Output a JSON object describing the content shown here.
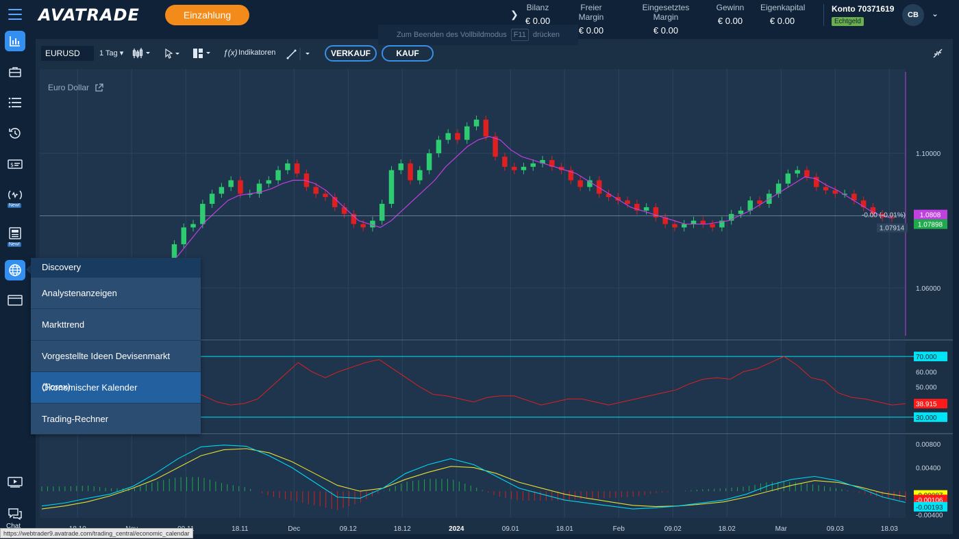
{
  "header": {
    "logo": "AVATRADE",
    "deposit_label": "Einzahlung",
    "stats": [
      {
        "label": "Bilanz",
        "value": "€ 0.00"
      },
      {
        "label": "Freier Margin",
        "value": "€ 0.00"
      },
      {
        "label": "Eingesetztes Margin",
        "value": "€ 0.00"
      },
      {
        "label": "Gewinn",
        "value": "€ 0.00"
      },
      {
        "label": "Eigenkapital",
        "value": "€ 0.00"
      }
    ],
    "account_label": "Konto 70371619",
    "account_badge": "Echtgeld",
    "avatar_initials": "CB",
    "fullscreen_hint_before": "Zum Beenden des Vollbildmodus",
    "fullscreen_key": "F11",
    "fullscreen_hint_after": "drücken"
  },
  "sidebar": {
    "new_badge": "New!",
    "chat_label": "Chat",
    "icons": [
      "chart-icon",
      "briefcase-icon",
      "list-icon",
      "history-icon",
      "money-icon",
      "signal-icon",
      "news-icon",
      "globe-icon",
      "window-icon",
      "video-icon",
      "chat-icon"
    ]
  },
  "toolbar": {
    "symbol": "EURUSD",
    "timeframe": "1 Tag",
    "indicators_label": "Indikatoren",
    "sell_label": "VERKAUF",
    "buy_label": "KAUF"
  },
  "chart_title": "Euro Dollar",
  "discovery_menu": {
    "title": "Discovery",
    "items": [
      "Analystenanzeigen",
      "Markttrend",
      "Vorgestellte Ideen Devisenmarkt (Forex)",
      "Ökonomischer Kalender",
      "Trading-Rechner"
    ],
    "selected_index": 3
  },
  "status_url": "https://webtrader9.avatrade.com/trading_central/economic_calendar",
  "chart_data": [
    {
      "type": "candlestick",
      "title": "Euro Dollar",
      "symbol": "EURUSD",
      "ylim": [
        1.045,
        1.125
      ],
      "y_ticks": [
        "1.10000",
        "1.06000"
      ],
      "last_price": "1.07898",
      "price_labels": [
        "1.0808",
        "1.07914"
      ],
      "change_label": "-0.00 (-0.01%)",
      "close_path": [
        1.064,
        1.065,
        1.066,
        1.0655,
        1.063,
        1.062,
        1.064,
        1.073,
        1.078,
        1.079,
        1.085,
        1.088,
        1.09,
        1.092,
        1.088,
        1.088,
        1.091,
        1.092,
        1.095,
        1.097,
        1.094,
        1.09,
        1.088,
        1.087,
        1.084,
        1.082,
        1.079,
        1.078,
        1.08,
        1.085,
        1.095,
        1.097,
        1.092,
        1.095,
        1.1,
        1.104,
        1.106,
        1.104,
        1.108,
        1.11,
        1.105,
        1.099,
        1.096,
        1.095,
        1.096,
        1.097,
        1.098,
        1.096,
        1.095,
        1.092,
        1.09,
        1.092,
        1.088,
        1.087,
        1.086,
        1.085,
        1.083,
        1.084,
        1.081,
        1.079,
        1.078,
        1.079,
        1.08,
        1.079,
        1.078,
        1.08,
        1.082,
        1.083,
        1.086,
        1.085,
        1.088,
        1.091,
        1.094,
        1.095,
        1.093,
        1.09,
        1.089,
        1.088,
        1.088,
        1.086,
        1.084,
        1.082,
        1.081,
        1.0808
      ],
      "ma_path": [
        1.06,
        1.061,
        1.062,
        1.063,
        1.064,
        1.065,
        1.068,
        1.072,
        1.076,
        1.08,
        1.083,
        1.086,
        1.0875,
        1.088,
        1.0885,
        1.0895,
        1.091,
        1.092,
        1.092,
        1.091,
        1.089,
        1.086,
        1.083,
        1.08,
        1.079,
        1.078,
        1.08,
        1.083,
        1.086,
        1.089,
        1.092,
        1.096,
        1.099,
        1.102,
        1.104,
        1.105,
        1.104,
        1.101,
        1.099,
        1.098,
        1.097,
        1.096,
        1.095,
        1.094,
        1.092,
        1.09,
        1.088,
        1.086,
        1.084,
        1.083,
        1.082,
        1.081,
        1.08,
        1.079,
        1.079,
        1.079,
        1.0795,
        1.08,
        1.0815,
        1.083,
        1.085,
        1.087,
        1.089,
        1.091,
        1.093,
        1.0925,
        1.0905,
        1.089,
        1.087,
        1.085,
        1.083,
        1.0815,
        1.0808
      ]
    },
    {
      "type": "line",
      "name": "RSI",
      "ylim": [
        20,
        80
      ],
      "y_ticks": [
        "70.000",
        "60.000",
        "50.000",
        "30.000"
      ],
      "levels": [
        70,
        30
      ],
      "last_value": "38.915",
      "values": [
        62,
        66,
        64,
        66,
        68,
        67,
        70,
        71,
        69,
        62,
        56,
        48,
        44,
        40,
        38,
        39,
        42,
        50,
        58,
        66,
        60,
        56,
        60,
        63,
        66,
        68,
        62,
        56,
        50,
        45,
        44,
        42,
        40,
        43,
        44,
        44,
        41,
        38,
        40,
        42,
        42,
        40,
        38,
        40,
        42,
        44,
        46,
        48,
        52,
        55,
        56,
        55,
        60,
        62,
        66,
        70,
        64,
        56,
        54,
        46,
        43,
        42,
        40,
        38,
        38.915
      ]
    },
    {
      "type": "line",
      "name": "MACD",
      "ylim": [
        -0.0045,
        0.0095
      ],
      "y_ticks": [
        "0.00800",
        "0.00400",
        "-0.00400"
      ],
      "value_labels": [
        "-0.00087",
        "-0.00106",
        "-0.00193"
      ],
      "macd": [
        -0.0025,
        -0.002,
        -0.0012,
        -0.0005,
        0.0008,
        0.003,
        0.0055,
        0.0075,
        0.0078,
        0.0076,
        0.006,
        0.004,
        0.0015,
        -0.001,
        -0.0012,
        0.0005,
        0.003,
        0.0045,
        0.0055,
        0.0045,
        0.0025,
        0.0005,
        -0.0005,
        -0.0015,
        -0.002,
        -0.0025,
        -0.003,
        -0.0028,
        -0.0025,
        -0.002,
        -0.0015,
        -0.0005,
        0.001,
        0.002,
        0.0025,
        0.0018,
        0.0005,
        -0.001,
        -0.0019
      ],
      "signal": [
        -0.003,
        -0.0025,
        -0.0018,
        -0.0008,
        0.0005,
        0.002,
        0.004,
        0.006,
        0.007,
        0.0072,
        0.0065,
        0.005,
        0.003,
        0.001,
        0.0,
        0.0005,
        0.002,
        0.0032,
        0.0042,
        0.004,
        0.003,
        0.0015,
        0.0005,
        -0.0005,
        -0.0012,
        -0.0018,
        -0.0024,
        -0.0026,
        -0.0025,
        -0.0022,
        -0.0018,
        -0.001,
        0.0,
        0.001,
        0.0018,
        0.0015,
        0.0007,
        -0.0003,
        -0.0009
      ]
    }
  ],
  "x_axis_labels": [
    "18.10",
    "Nov",
    "09.11",
    "18.11",
    "Dec",
    "09.12",
    "18.12",
    "2024",
    "09.01",
    "18.01",
    "Feb",
    "09.02",
    "18.02",
    "Mar",
    "09.03",
    "18.03"
  ],
  "colors": {
    "accent": "#3490f0",
    "deposit": "#f38b1a",
    "bull": "#2ecc71",
    "bear": "#e02020",
    "ma": "#c040e0",
    "rsi": "#e02020",
    "rsi_level": "#00e5f5",
    "macd": "#00d8f0",
    "signal": "#e8e030"
  }
}
